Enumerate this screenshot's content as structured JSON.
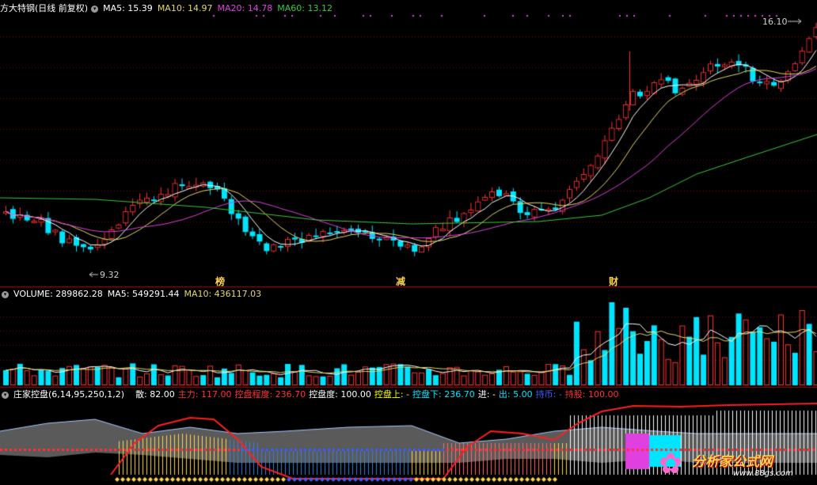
{
  "price_panel": {
    "title": "方大特钢(日线 前复权)",
    "ma5": "MA5: 15.39",
    "ma10": "MA10: 14.97",
    "ma20": "MA20: 14.78",
    "ma60": "MA60: 13.12",
    "high_label": "16.10",
    "low_label": "9.32",
    "markers": [
      "榜",
      "减",
      "财"
    ],
    "colors": {
      "up": "#ff3232",
      "down": "#00e5ff",
      "ma5": "#ffffff",
      "ma10": "#e6d86a",
      "ma20": "#e040e0",
      "ma60": "#3cc83c"
    }
  },
  "volume_panel": {
    "title": "VOLUME: 289862.28",
    "ma5": "MA5: 549291.44",
    "ma10": "MA10: 436117.03"
  },
  "indicator_panel": {
    "name": "庄家控盘(6,14,95,250,1,2)",
    "items": [
      {
        "key": "散",
        "text": "散: 82.00",
        "color": "#ffffff"
      },
      {
        "key": "主力",
        "text": "主力: 117.00",
        "color": "#ff3232"
      },
      {
        "key": "控盘程度",
        "text": "控盘程度: 236.70",
        "color": "#ff3232"
      },
      {
        "key": "控盘度",
        "text": "控盘度: 100.00",
        "color": "#ffffff"
      },
      {
        "key": "控盘上",
        "text": "控盘上: -",
        "color": "#ffff00"
      },
      {
        "key": "控盘下",
        "text": "控盘下: 236.70",
        "color": "#00e5ff"
      },
      {
        "key": "进",
        "text": "进: -",
        "color": "#ffffff"
      },
      {
        "key": "出",
        "text": "出: 5.00",
        "color": "#00e5ff"
      },
      {
        "key": "持币",
        "text": "持币: -",
        "color": "#3c5cff"
      },
      {
        "key": "持股",
        "text": "持股: 100.00",
        "color": "#ff3232"
      }
    ]
  },
  "watermark": {
    "name": "分析家公式网",
    "url": "www.88gs.com"
  }
}
